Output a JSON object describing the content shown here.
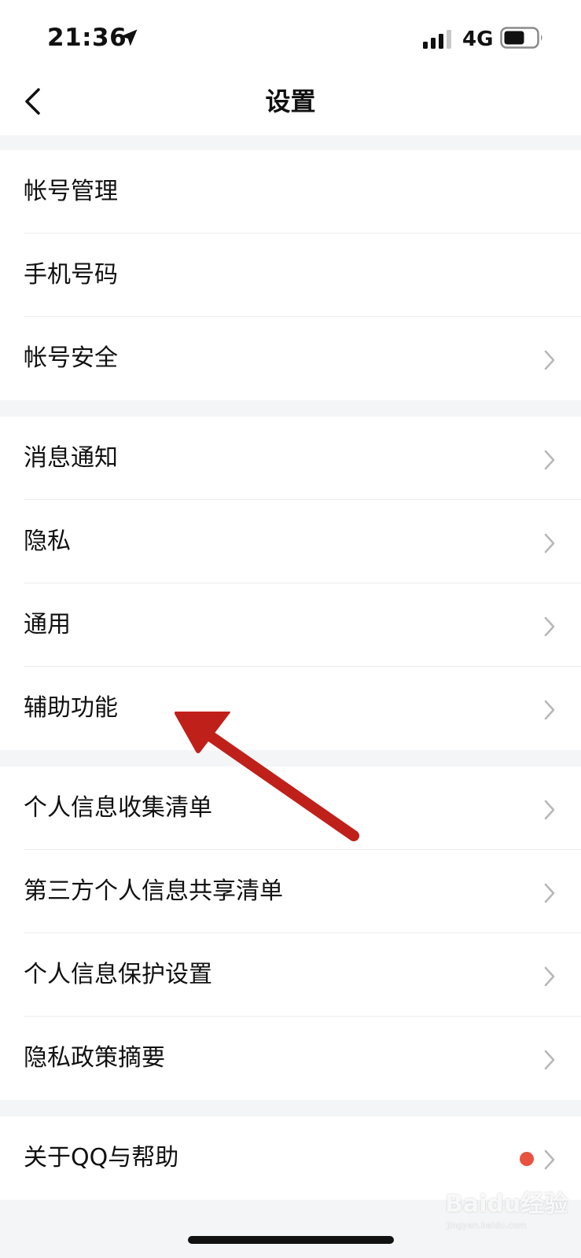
{
  "status_bar": {
    "time": "21:36",
    "network": "4G",
    "icons": [
      "location-arrow-icon",
      "signal-bars-icon",
      "battery-icon"
    ]
  },
  "nav": {
    "title": "设置",
    "back_icon": "chevron-left-icon"
  },
  "groups": [
    {
      "items": [
        {
          "label": "帐号管理",
          "chevron": false
        },
        {
          "label": "手机号码",
          "chevron": false
        },
        {
          "label": "帐号安全",
          "chevron": true
        }
      ]
    },
    {
      "items": [
        {
          "label": "消息通知",
          "chevron": true
        },
        {
          "label": "隐私",
          "chevron": true
        },
        {
          "label": "通用",
          "chevron": true
        },
        {
          "label": "辅助功能",
          "chevron": true
        }
      ]
    },
    {
      "items": [
        {
          "label": "个人信息收集清单",
          "chevron": true
        },
        {
          "label": "第三方个人信息共享清单",
          "chevron": true
        },
        {
          "label": "个人信息保护设置",
          "chevron": true
        },
        {
          "label": "隐私政策摘要",
          "chevron": true
        }
      ]
    },
    {
      "items": [
        {
          "label": "关于QQ与帮助",
          "chevron": true,
          "badge": true
        }
      ]
    }
  ],
  "watermark": {
    "logo": "Baidu经验",
    "site": "jingyan.baidu.com"
  },
  "colors": {
    "background": "#f4f5f7",
    "surface": "#ffffff",
    "text": "#111111",
    "chevron": "#b8b8b8",
    "badge": "#e8533f",
    "arrow": "#c0201a"
  }
}
